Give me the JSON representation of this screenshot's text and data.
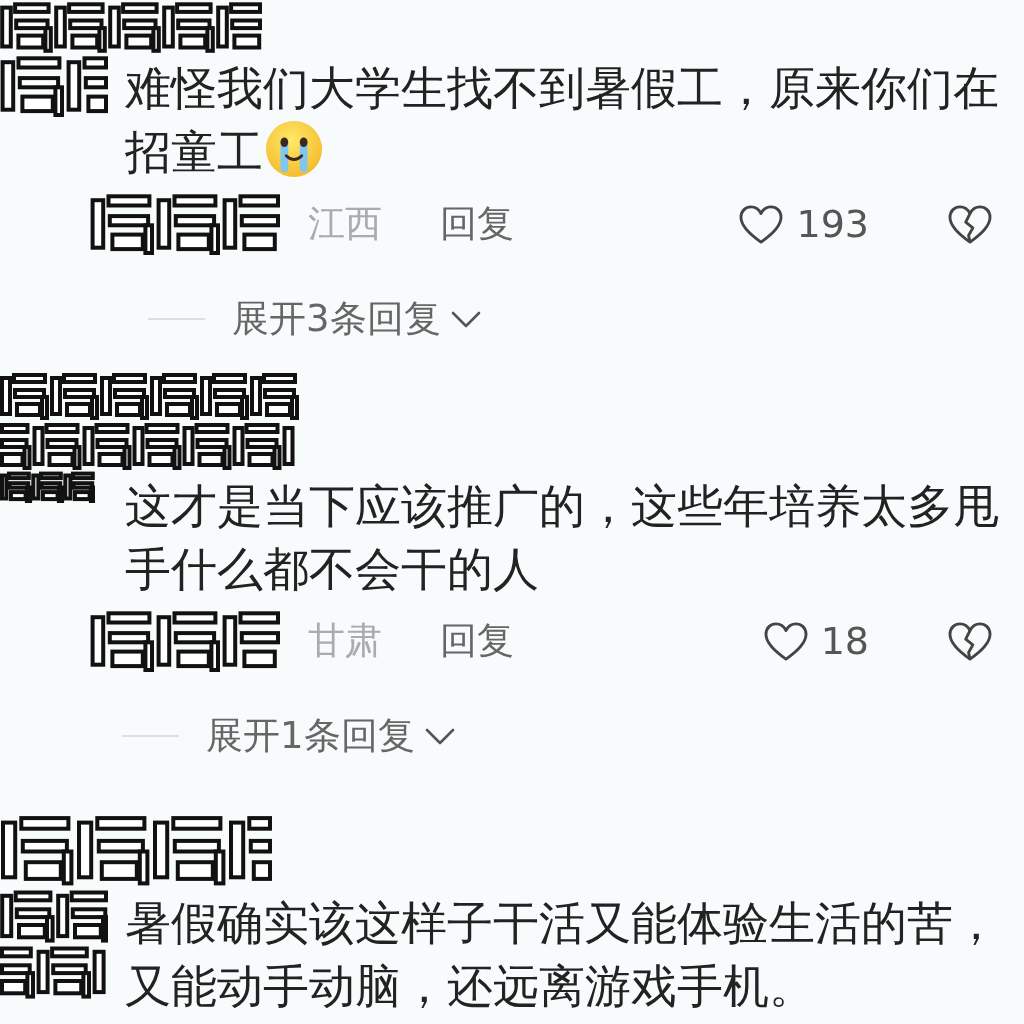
{
  "comments": [
    {
      "author_hidden": true,
      "text": "难怪我们大学生找不到暑假工，原来你们在招童工",
      "ends_with_emoji": true,
      "location": "江西",
      "reply_label": "回复",
      "likes": "193",
      "liked": false,
      "disliked": false,
      "expand_replies": "展开3条回复"
    },
    {
      "author_hidden": true,
      "text": "这才是当下应该推广的，这些年培养太多甩手什么都不会干的人",
      "location": "甘肃",
      "reply_label": "回复",
      "likes": "18",
      "liked": false,
      "disliked": false,
      "expand_replies": "展开1条回复"
    },
    {
      "author_hidden": true,
      "text": "暑假确实该这样子干活又能体验生活的苦，又能动手动脑，还远离游戏手机。"
    }
  ]
}
